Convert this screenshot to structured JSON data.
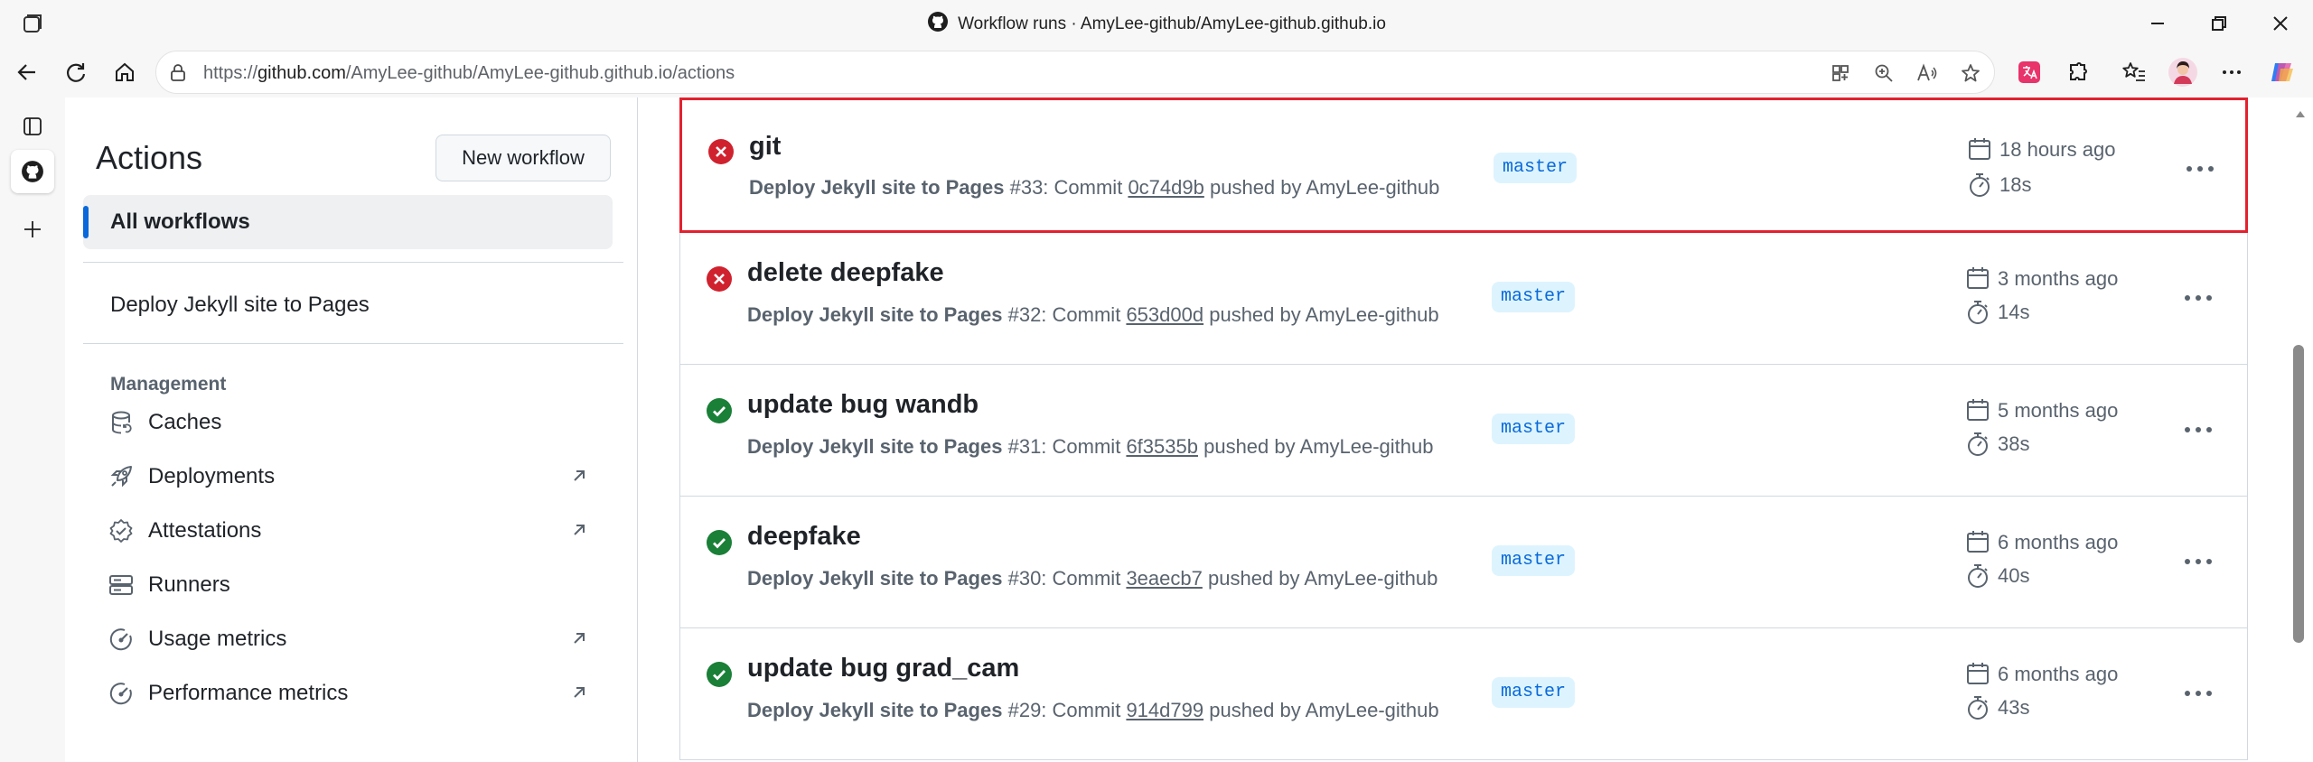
{
  "browser": {
    "window_title": "Workflow runs · AmyLee-github/AmyLee-github.github.io",
    "url_prefix": "https://",
    "url_host": "github.com",
    "url_path": "/AmyLee-github/AmyLee-github.github.io/actions"
  },
  "sidebar": {
    "title": "Actions",
    "new_workflow_label": "New workflow",
    "all_workflows_label": "All workflows",
    "workflows": [
      "Deploy Jekyll site to Pages"
    ],
    "management_heading": "Management",
    "management_items": [
      {
        "label": "Caches",
        "icon": "database-icon",
        "external": false
      },
      {
        "label": "Deployments",
        "icon": "rocket-icon",
        "external": true
      },
      {
        "label": "Attestations",
        "icon": "verified-icon",
        "external": true
      },
      {
        "label": "Runners",
        "icon": "server-icon",
        "external": false
      },
      {
        "label": "Usage metrics",
        "icon": "meter-icon",
        "external": true
      },
      {
        "label": "Performance metrics",
        "icon": "meter-icon",
        "external": true
      }
    ]
  },
  "runs": [
    {
      "title": "git",
      "status": "failure",
      "workflow": "Deploy Jekyll site to Pages",
      "run_label": "#33: Commit",
      "commit": "0c74d9b",
      "pushed_by": "pushed by AmyLee-github",
      "branch": "master",
      "when": "18 hours ago",
      "duration": "18s",
      "highlighted": true
    },
    {
      "title": "delete deepfake",
      "status": "failure",
      "workflow": "Deploy Jekyll site to Pages",
      "run_label": "#32: Commit",
      "commit": "653d00d",
      "pushed_by": "pushed by AmyLee-github",
      "branch": "master",
      "when": "3 months ago",
      "duration": "14s",
      "highlighted": false
    },
    {
      "title": "update bug wandb",
      "status": "success",
      "workflow": "Deploy Jekyll site to Pages",
      "run_label": "#31: Commit",
      "commit": "6f3535b",
      "pushed_by": "pushed by AmyLee-github",
      "branch": "master",
      "when": "5 months ago",
      "duration": "38s",
      "highlighted": false
    },
    {
      "title": "deepfake",
      "status": "success",
      "workflow": "Deploy Jekyll site to Pages",
      "run_label": "#30: Commit",
      "commit": "3eaecb7",
      "pushed_by": "pushed by AmyLee-github",
      "branch": "master",
      "when": "6 months ago",
      "duration": "40s",
      "highlighted": false
    },
    {
      "title": "update bug grad_cam",
      "status": "success",
      "workflow": "Deploy Jekyll site to Pages",
      "run_label": "#29: Commit",
      "commit": "914d799",
      "pushed_by": "pushed by AmyLee-github",
      "branch": "master",
      "when": "6 months ago",
      "duration": "43s",
      "highlighted": false
    }
  ],
  "colors": {
    "failure": "#cf222e",
    "success": "#1a7f37",
    "highlight": "#e3212f",
    "accent": "#0969da"
  }
}
